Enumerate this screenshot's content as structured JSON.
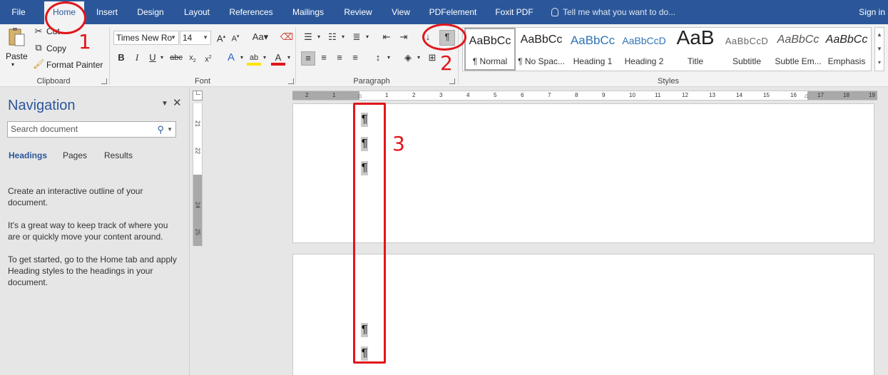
{
  "tabs": [
    {
      "label": "File"
    },
    {
      "label": "Home"
    },
    {
      "label": "Insert"
    },
    {
      "label": "Design"
    },
    {
      "label": "Layout"
    },
    {
      "label": "References"
    },
    {
      "label": "Mailings"
    },
    {
      "label": "Review"
    },
    {
      "label": "View"
    },
    {
      "label": "PDFelement"
    },
    {
      "label": "Foxit PDF"
    }
  ],
  "tell_me": "Tell me what you want to do...",
  "sign_in": "Sign in",
  "clipboard": {
    "paste": "Paste",
    "cut": "Cut",
    "copy": "Copy",
    "format_painter": "Format Painter",
    "label": "Clipboard"
  },
  "font": {
    "name": "Times New Ro",
    "size": "14",
    "label": "Font"
  },
  "paragraph": {
    "label": "Paragraph",
    "show_marks_glyph": "¶"
  },
  "styles": {
    "label": "Styles",
    "items": [
      {
        "preview": "AaBbCc",
        "name": "¶ Normal"
      },
      {
        "preview": "AaBbCc",
        "name": "¶ No Spac..."
      },
      {
        "preview": "AaBbCc",
        "name": "Heading 1"
      },
      {
        "preview": "AaBbCcD",
        "name": "Heading 2"
      },
      {
        "preview": "AaB",
        "name": "Title"
      },
      {
        "preview": "AaBbCcD",
        "name": "Subtitle"
      },
      {
        "preview": "AaBbCc",
        "name": "Subtle Em..."
      },
      {
        "preview": "AaBbCc",
        "name": "Emphasis"
      }
    ]
  },
  "navigation": {
    "title": "Navigation",
    "search_placeholder": "Search document",
    "tabs": [
      "Headings",
      "Pages",
      "Results"
    ],
    "paragraphs": [
      "Create an interactive outline of your document.",
      "It's a great way to keep track of where you are or quickly move your content around.",
      "To get started, go to the Home tab and apply Heading styles to the headings in your document."
    ]
  },
  "ruler": {
    "h_ticks": [
      "2",
      "1",
      "1",
      "2",
      "3",
      "4",
      "5",
      "6",
      "7",
      "8",
      "9",
      "10",
      "11",
      "12",
      "13",
      "14",
      "15",
      "16",
      "17",
      "18",
      "19"
    ],
    "v_ticks": [
      "21",
      "22",
      "24",
      "25"
    ]
  },
  "document": {
    "mark": "¶"
  },
  "annotations": {
    "step1": "1",
    "step2": "2",
    "step3": "3"
  },
  "colors": {
    "ribbon_blue": "#2b579a",
    "highlight_red": "#e0161b"
  }
}
